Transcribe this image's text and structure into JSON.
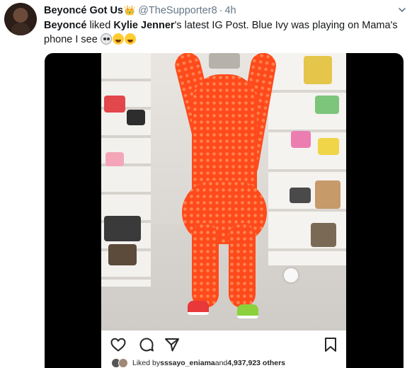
{
  "tweet": {
    "display_name": "Beyoncé Got Us",
    "crown_emoji": "👑",
    "handle": "@TheSupporter8",
    "separator": "·",
    "time": "4h",
    "text": {
      "actor": "Beyoncé",
      "verb": " liked ",
      "subject": "Kylie Jenner",
      "rest": "'s latest IG Post. Blue Ivy was playing on Mama's phone I see"
    },
    "emojis": [
      "skull-emoji",
      "joy-emoji",
      "joy-emoji"
    ]
  },
  "instagram": {
    "icons": [
      "heart-icon",
      "comment-icon",
      "share-icon",
      "bookmark-icon"
    ],
    "likes_prefix": "Liked by ",
    "likes_user": "sssayo_eniama",
    "likes_mid": " and ",
    "likes_count": "4,937,923 others"
  },
  "colors": {
    "text": "#14171a",
    "secondary": "#657786",
    "media_bg": "#000000",
    "outfit": "#ff4a1c"
  }
}
